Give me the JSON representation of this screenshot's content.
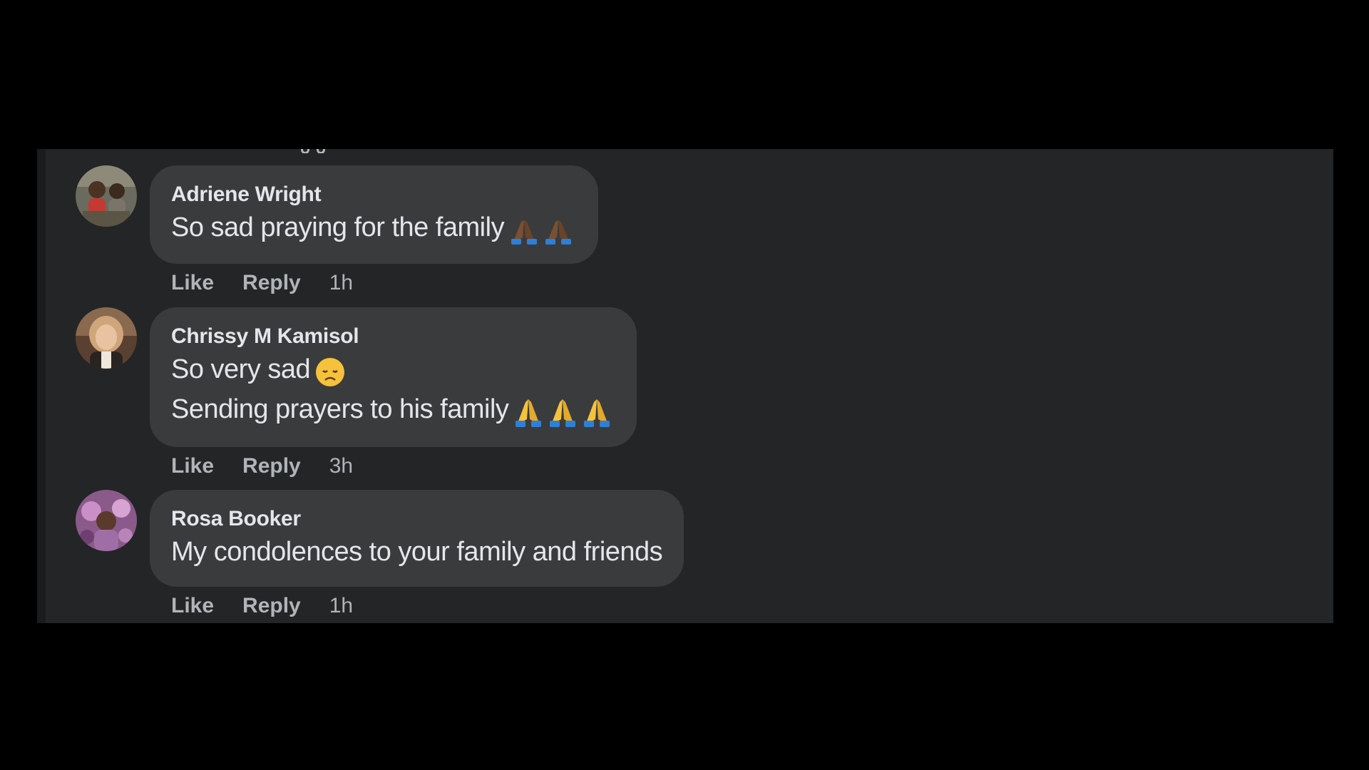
{
  "comments": [
    {
      "author": "Adriene Wright",
      "lines": [
        "So sad praying for the family"
      ],
      "emoji": [
        "praying-hands-dark-skin-emoji",
        "praying-hands-dark-skin-emoji"
      ],
      "like_label": "Like",
      "reply_label": "Reply",
      "time": "1h"
    },
    {
      "author": "Chrissy M Kamisol",
      "lines": [
        "So very sad",
        "Sending prayers to his family"
      ],
      "emoji_line1": [
        "disappointed-face-emoji"
      ],
      "emoji_line2": [
        "praying-hands-emoji",
        "praying-hands-emoji",
        "praying-hands-emoji"
      ],
      "like_label": "Like",
      "reply_label": "Reply",
      "time": "3h"
    },
    {
      "author": "Rosa Booker",
      "lines": [
        "My condolences to your family and friends"
      ],
      "like_label": "Like",
      "reply_label": "Reply",
      "time": "1h"
    }
  ],
  "colors": {
    "page_background": "#000000",
    "panel_background": "#242526",
    "bubble_background": "#3a3b3c",
    "primary_text": "#e4e6eb",
    "secondary_text": "#b0b3b8"
  }
}
